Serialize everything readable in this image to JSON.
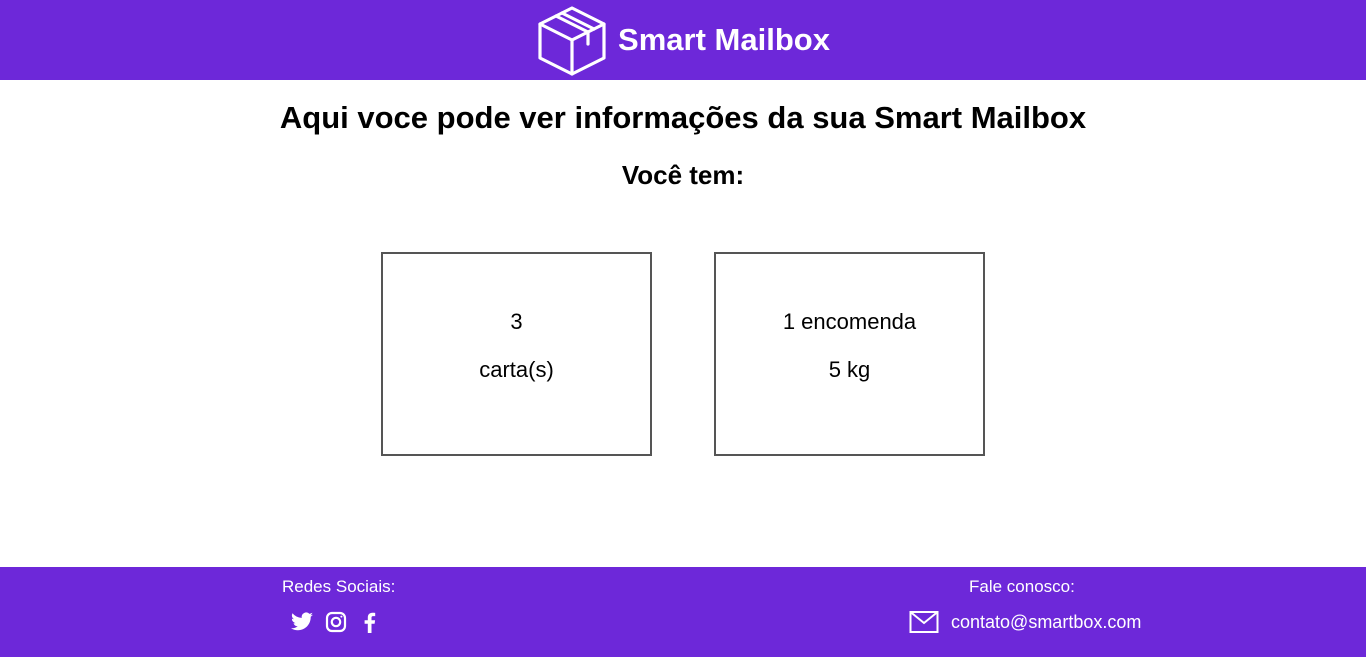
{
  "header": {
    "brand_name": "Smart Mailbox",
    "logo_icon": "package-box-icon"
  },
  "main": {
    "title": "Aqui voce pode ver informações da sua Smart Mailbox",
    "subtitle": "Você tem:",
    "cards": [
      {
        "line1": "3",
        "line2": "carta(s)"
      },
      {
        "line1": "1 encomenda",
        "line2": "5 kg"
      }
    ]
  },
  "footer": {
    "social_title": "Redes Sociais:",
    "social_icons": [
      "twitter-icon",
      "instagram-icon",
      "facebook-icon"
    ],
    "contact_title": "Fale conosco:",
    "contact_email": "contato@smartbox.com",
    "contact_icon": "mail-icon"
  },
  "colors": {
    "brand_purple": "#6d28d9",
    "card_border": "#555555",
    "text": "#000000",
    "footer_text": "#ffffff"
  }
}
